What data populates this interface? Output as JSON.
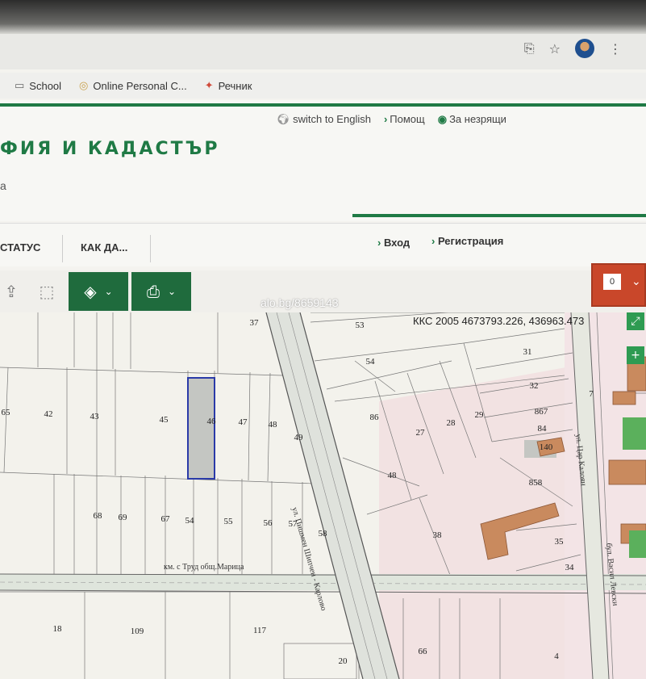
{
  "browser": {
    "bookmarks": [
      {
        "label": "School",
        "icon": "folder-icon"
      },
      {
        "label": "Online Personal C...",
        "icon": "site-icon"
      },
      {
        "label": "Речник",
        "icon": "site-icon"
      }
    ]
  },
  "site": {
    "top_links": [
      "switch to English",
      "Помощ",
      "За незрящи"
    ],
    "logo_text": "ФИЯ И КАДАСТЪР",
    "subtitle": "а",
    "nav": [
      "СТАТУС",
      "КАК ДА..."
    ],
    "auth_links": [
      "Вход",
      "Регистрация"
    ],
    "brand_color": "#1f7a45",
    "accent_color": "#c9472a"
  },
  "toolbar": {
    "order_count": "0"
  },
  "map": {
    "coordinates": "ККС 2005 4673793.226, 436963.473",
    "watermark": "alo.bg/8659143",
    "zoom_in": "+",
    "expand": "⤢",
    "parcels": [
      {
        "n": "37"
      },
      {
        "n": "53"
      },
      {
        "n": "31"
      },
      {
        "n": "54"
      },
      {
        "n": "32"
      },
      {
        "n": "65"
      },
      {
        "n": "42"
      },
      {
        "n": "43"
      },
      {
        "n": "45"
      },
      {
        "n": "46"
      },
      {
        "n": "47"
      },
      {
        "n": "48"
      },
      {
        "n": "49"
      },
      {
        "n": "86"
      },
      {
        "n": "27"
      },
      {
        "n": "28"
      },
      {
        "n": "29"
      },
      {
        "n": "867"
      },
      {
        "n": "84"
      },
      {
        "n": "140"
      },
      {
        "n": "48"
      },
      {
        "n": "858"
      },
      {
        "n": "68"
      },
      {
        "n": "69"
      },
      {
        "n": "67"
      },
      {
        "n": "54"
      },
      {
        "n": "55"
      },
      {
        "n": "56"
      },
      {
        "n": "57"
      },
      {
        "n": "58"
      },
      {
        "n": "38"
      },
      {
        "n": "35"
      },
      {
        "n": "34"
      },
      {
        "n": "7"
      },
      {
        "n": "18"
      },
      {
        "n": "109"
      },
      {
        "n": "117"
      },
      {
        "n": "66"
      },
      {
        "n": "20"
      },
      {
        "n": "4"
      }
    ],
    "streets": [
      "км. с Труд общ.Марица",
      "ул. Пишмен Шипчен - Карлово",
      "бул. Васил Левски",
      "ул. Цар Калоян"
    ]
  }
}
